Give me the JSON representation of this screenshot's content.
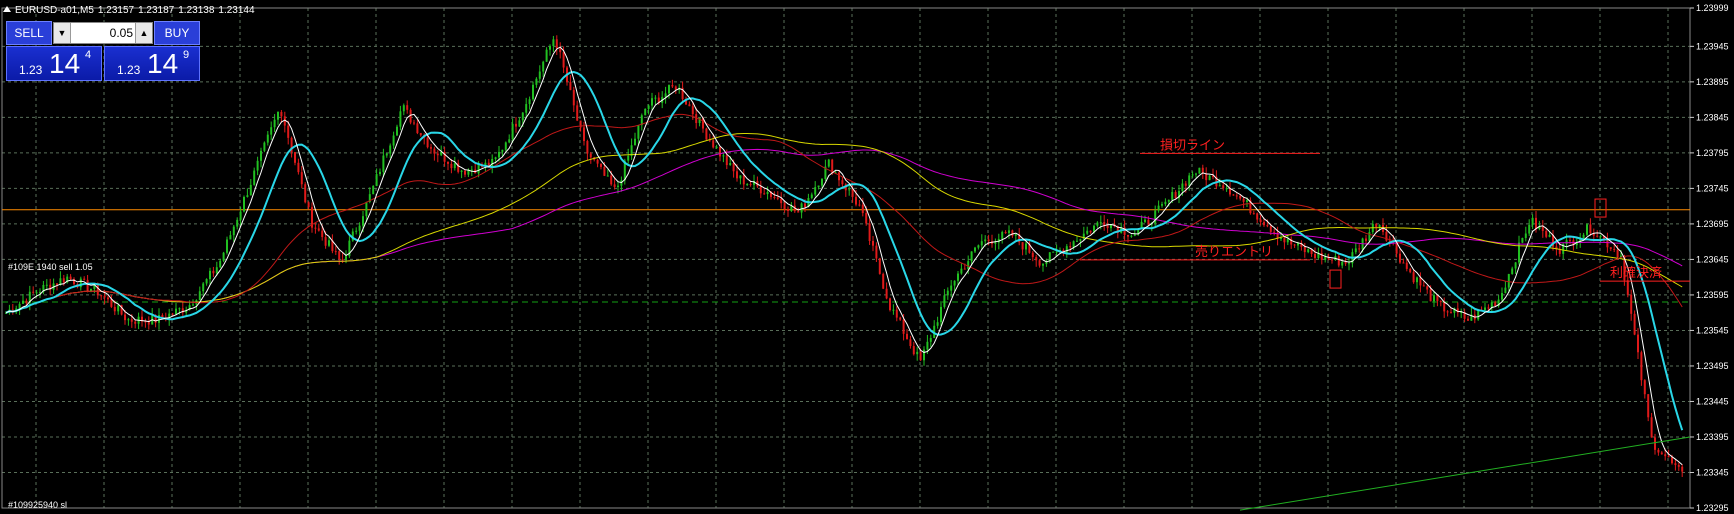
{
  "header": {
    "symbol": "EURUSD-a01,M5",
    "open": "1.23157",
    "high": "1.23187",
    "low": "1.23138",
    "close": "1.23144"
  },
  "trade_panel": {
    "sell_label": "SELL",
    "buy_label": "BUY",
    "lot": "0.05",
    "sell_prefix": "1.23",
    "sell_big": "14",
    "sell_sup": "4",
    "buy_prefix": "1.23",
    "buy_big": "14",
    "buy_sup": "9"
  },
  "order_labels": {
    "sell_line": "#109E 1940 sell 1.05",
    "stop_line": "#109925940 sl"
  },
  "colors": {
    "background": "#000000",
    "grid": "#5a6f5a",
    "bull": "#21c021",
    "bear": "#e01a1a",
    "ma_white": "#ffffff",
    "ma_cyan": "#29d7e8",
    "ma_red": "#c01818",
    "ma_yellow": "#d8d800",
    "ma_magenta": "#d000d0",
    "ma_green": "#22b022",
    "hline_orange": "#ff8c00",
    "hline_green_dash": "#14a014",
    "annotation": "#ff2020",
    "axis_text": "#ffffff"
  },
  "chart_data": {
    "type": "candlestick",
    "ylim": [
      1.23295,
      1.23999
    ],
    "y_ticks": [
      "1.23999",
      "1.23945",
      "1.23895",
      "1.23845",
      "1.23795",
      "1.23745",
      "1.23695",
      "1.23645",
      "1.23595",
      "1.23545",
      "1.23495",
      "1.23445",
      "1.23395",
      "1.23345",
      "1.23295"
    ],
    "price_path": [
      1.2357,
      1.236,
      1.2362,
      1.236,
      1.2356,
      1.2356,
      1.2358,
      1.2364,
      1.2375,
      1.2386,
      1.237,
      1.2364,
      1.2374,
      1.2386,
      1.238,
      1.2377,
      1.2378,
      1.2386,
      1.2396,
      1.238,
      1.2374,
      1.2386,
      1.2389,
      1.2382,
      1.2376,
      1.2374,
      1.2371,
      1.2378,
      1.2372,
      1.2358,
      1.235,
      1.2361,
      1.2367,
      1.2368,
      1.2364,
      1.2367,
      1.237,
      1.2368,
      1.2372,
      1.2377,
      1.2375,
      1.2371,
      1.2367,
      1.2365,
      1.2364,
      1.237,
      1.2363,
      1.2358,
      1.2356,
      1.2359,
      1.237,
      1.2366,
      1.2369,
      1.2365,
      1.2339,
      1.2334
    ],
    "hlines": [
      {
        "name": "orange",
        "value": 1.23715
      },
      {
        "name": "green-dashed",
        "value": 1.23585
      }
    ],
    "annotations": [
      {
        "text": "損切ライン",
        "price": 1.238
      },
      {
        "text": "売りエントリ",
        "price": 1.2365
      },
      {
        "text": "利確決済",
        "price": 1.2362
      }
    ]
  }
}
